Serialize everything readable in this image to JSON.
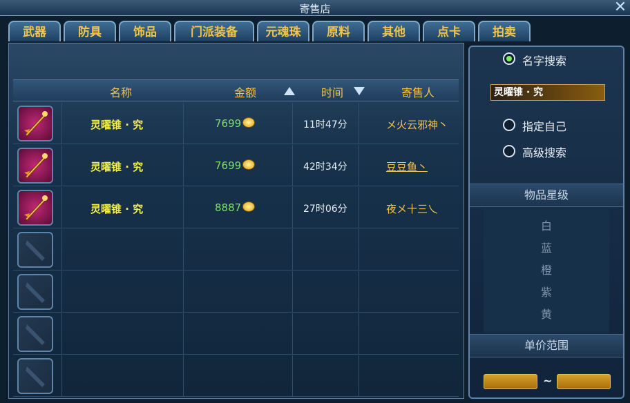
{
  "window": {
    "title": "寄售店",
    "close": "✕"
  },
  "tabs": [
    {
      "label": "武器"
    },
    {
      "label": "防具"
    },
    {
      "label": "饰品"
    },
    {
      "label": "门派装备"
    },
    {
      "label": "元魂珠"
    },
    {
      "label": "原料"
    },
    {
      "label": "其他"
    },
    {
      "label": "点卡"
    },
    {
      "label": "拍卖"
    }
  ],
  "table": {
    "headers": {
      "name": "名称",
      "price": "金额",
      "time": "时间",
      "seller": "寄售人"
    },
    "sort": {
      "price": "asc",
      "time": "desc"
    },
    "rows": [
      {
        "icon": "weapon-icon",
        "name": "灵曜锥 · 究",
        "price": "7699",
        "time": "11时47分",
        "seller": "メ火云邪神丶"
      },
      {
        "icon": "weapon-icon",
        "name": "灵曜锥 · 究",
        "price": "7699",
        "time": "42时34分",
        "seller": "豆豆鱼丶"
      },
      {
        "icon": "weapon-icon",
        "name": "灵曜锥 · 究",
        "price": "8887",
        "time": "27时06分",
        "seller": "夜メ十三乀"
      },
      {
        "icon": "empty-slot-icon",
        "name": "",
        "price": "",
        "time": "",
        "seller": ""
      },
      {
        "icon": "empty-slot-icon",
        "name": "",
        "price": "",
        "time": "",
        "seller": ""
      },
      {
        "icon": "empty-slot-icon",
        "name": "",
        "price": "",
        "time": "",
        "seller": ""
      },
      {
        "icon": "empty-slot-icon",
        "name": "",
        "price": "",
        "time": "",
        "seller": ""
      }
    ]
  },
  "sidebar": {
    "name_search": {
      "label": "名字搜索",
      "selected": true
    },
    "search_value": "灵曜锥 · 究",
    "self_search": {
      "label": "指定自己",
      "selected": false
    },
    "advanced_search": {
      "label": "高级搜索",
      "selected": false
    },
    "star_section": {
      "title": "物品星级",
      "levels": [
        "白",
        "蓝",
        "橙",
        "紫",
        "黄"
      ]
    },
    "price_range": {
      "title": "单价范围",
      "separator": "~",
      "min": "",
      "max": ""
    }
  },
  "colors": {
    "tab_text": "#f2c44a",
    "item_name": "#f6f04a",
    "price": "#7de06a",
    "seller": "#f4c34d",
    "radio_on": "#7cf05c"
  }
}
